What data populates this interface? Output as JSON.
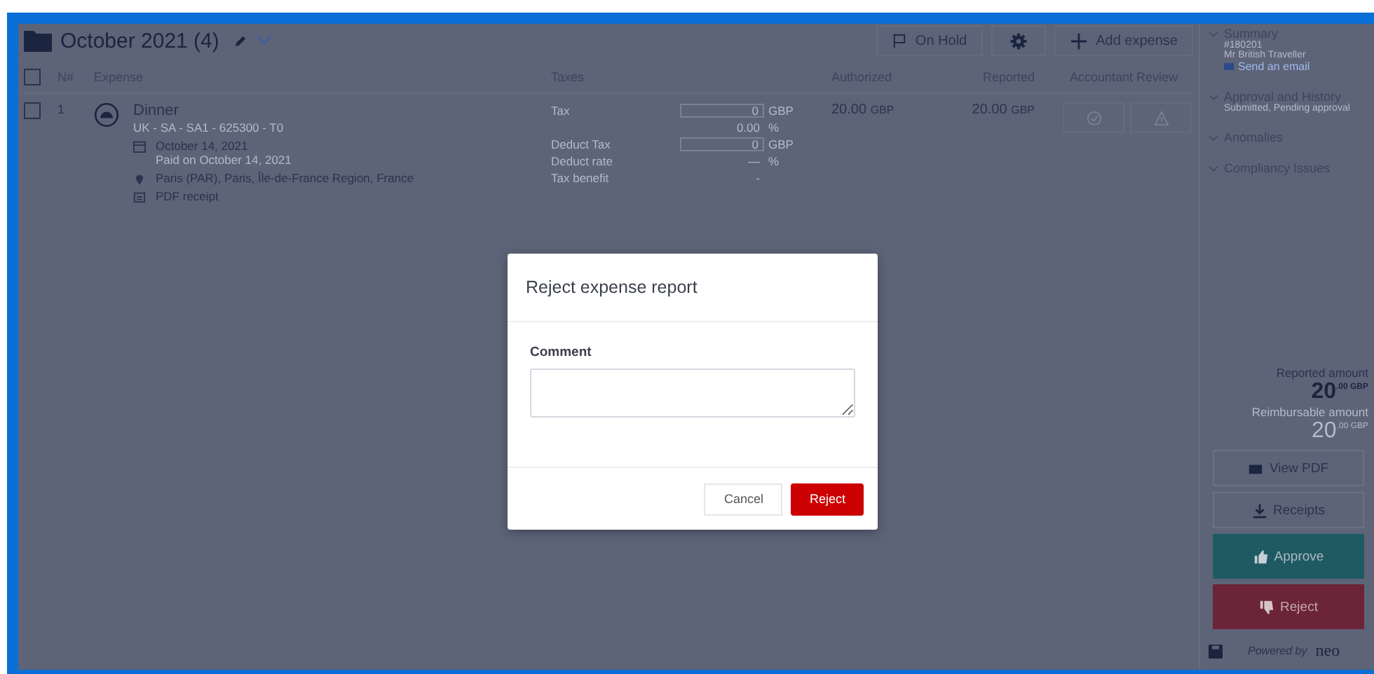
{
  "header": {
    "title": "October 2021 (4)",
    "buttons": [
      {
        "kind": "hold",
        "label": "On Hold"
      },
      {
        "kind": "settings"
      },
      {
        "kind": "add",
        "label": "Add expense"
      }
    ]
  },
  "table": {
    "select_all_checked": false,
    "columns": [
      "N#",
      "Expense",
      "Taxes",
      "Authorized",
      "Reported",
      "Accountant Review"
    ],
    "rows": [
      {
        "checked": false,
        "number": "1",
        "title": "Dinner",
        "code": "UK - SA - SA1 - 625300 - T0",
        "date": "October 14, 2021",
        "paid": "Paid on October 14, 2021",
        "location": "Paris (PAR), Paris, Île-de-France Region, France",
        "receipt": "PDF receipt",
        "taxes": [
          {
            "kind": "input",
            "label": "Tax",
            "value": "0",
            "unit": "GBP"
          },
          {
            "kind": "text",
            "value": "0.00",
            "unit": "%"
          },
          {
            "kind": "input",
            "label": "Deduct Tax",
            "value": "0",
            "unit": "GBP"
          },
          {
            "kind": "text",
            "label": "Deduct rate",
            "value": "—",
            "unit": "%"
          },
          {
            "kind": "text",
            "label": "Tax benefit",
            "value": "-"
          }
        ],
        "authorized": "20.00",
        "authorized_currency": "GBP",
        "reported": "20.00",
        "reported_currency": "GBP"
      }
    ]
  },
  "sidebar": {
    "sections": [
      {
        "title": "Summary",
        "lines": [
          "#180201",
          "Mr British Traveller"
        ],
        "link": "Send an email"
      },
      {
        "title": "Approval and History",
        "lines": [
          "Submitted, Pending approval"
        ]
      },
      {
        "title": "Anomalies"
      },
      {
        "title": "Compliancy Issues"
      }
    ],
    "reported_label": "Reported amount",
    "reported_amount": "20$^{.00 GBP}$",
    "reimbursable_label": "Reimbursable amount",
    "reimbursable_amount": "20$^{.00 GBP}$",
    "buttons": [
      {
        "kind": "pdf",
        "label": "View PDF"
      },
      {
        "kind": "receipts",
        "label": "Receipts"
      },
      {
        "kind": "approve",
        "label": "Approve"
      },
      {
        "kind": "reject",
        "label": "Reject"
      }
    ],
    "powered_by": "Powered by",
    "brand": "neo"
  },
  "dialog": {
    "title": "Reject expense report",
    "field_label": "Comment",
    "buttons": [
      {
        "kind": "cancel",
        "label": "Cancel"
      },
      {
        "kind": "reject",
        "label": "Reject"
      }
    ]
  }
}
